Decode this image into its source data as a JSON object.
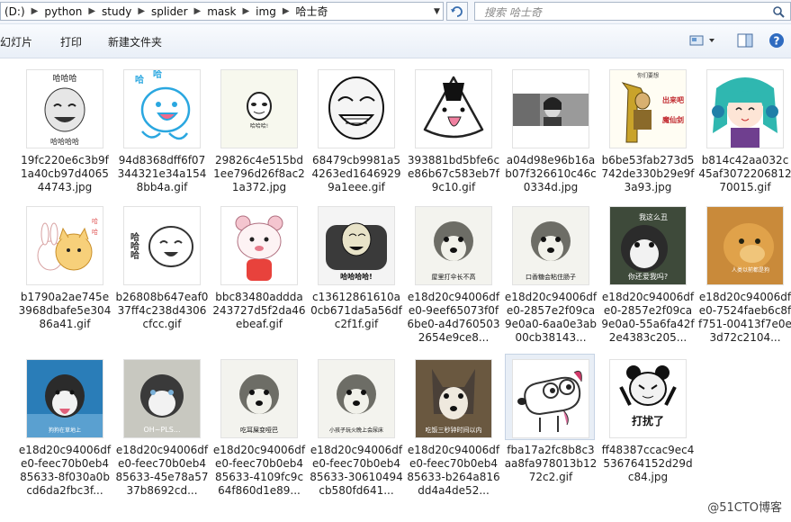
{
  "address": {
    "segments": [
      "(D:)",
      "python",
      "study",
      "splider",
      "mask",
      "img",
      "哈士奇"
    ]
  },
  "search": {
    "placeholder": "搜索 哈士奇"
  },
  "toolbar": {
    "slideshow": "幻灯片",
    "print": "打印",
    "new_folder": "新建文件夹"
  },
  "files": [
    {
      "name": "19fc220e6c3b9f1a40cb97d406544743.jpg",
      "icon": "meme-haha-face"
    },
    {
      "name": "94d8368dff6f07344321e34a1548bb4a.gif",
      "icon": "cartoon-blue-creature"
    },
    {
      "name": "29826c4e515bd1ee796d26f8ac21a372.jpg",
      "icon": "panda-face-meme"
    },
    {
      "name": "68479cb9981a54263ed16469299a1eee.gif",
      "icon": "laughing-rage-face"
    },
    {
      "name": "393881bd5bfe6ce86b67c583eb7f9c10.gif",
      "icon": "rice-ball-tongue"
    },
    {
      "name": "a04d98e96b16ab07f326610c46c0334d.jpg",
      "icon": "photo-person"
    },
    {
      "name": "b6be53fab273d5742de330b29e9f3a93.jpg",
      "icon": "warrior-meme"
    },
    {
      "name": "b814c42aa032c45af307220681270015.gif",
      "icon": "anime-girl"
    },
    {
      "name": "b1790a2ae745e3968dbafe5e30486a41.gif",
      "icon": "cat-bunny"
    },
    {
      "name": "b26808b647eaf037ff4c238d4306cfcc.gif",
      "icon": "white-blob-haha"
    },
    {
      "name": "bbc83480addda243727d5f2da46ebeaf.gif",
      "icon": "pink-bear"
    },
    {
      "name": "c13612861610a0cb671da5a56dfc2f1f.gif",
      "icon": "panda-chair-haha"
    },
    {
      "name": "e18d20c94006dfe0-9eef65073f0f6be0-a4d7605032654e9ce8...",
      "icon": "husky-photo"
    },
    {
      "name": "e18d20c94006dfe0-2857e2f09ca9e0a0-6aa0e3ab00cb38143...",
      "icon": "husky-photo"
    },
    {
      "name": "e18d20c94006dfe0-2857e2f09ca9e0a0-55a6fa42f2e4383c205...",
      "icon": "husky-photo"
    },
    {
      "name": "e18d20c94006dfe0-7524faeb6c8ff751-00413f7e0e3d72c2104...",
      "icon": "dog-photo"
    },
    {
      "name": "e18d20c94006dfe0-feec70b0eb485633-8f030a0bcd6da2fbc3f...",
      "icon": "husky-photo"
    },
    {
      "name": "e18d20c94006dfe0-feec70b0eb485633-45e78a5737b8692cd...",
      "icon": "husky-photo"
    },
    {
      "name": "e18d20c94006dfe0-feec70b0eb485633-4109fc9c64f860d1e89...",
      "icon": "husky-photo"
    },
    {
      "name": "e18d20c94006dfe0-feec70b0eb485633-30610494cb580fd641...",
      "icon": "husky-photo"
    },
    {
      "name": "e18d20c94006dfe0-feec70b0eb485633-b264a816dd4a4de52...",
      "icon": "husky-photo"
    },
    {
      "name": "fba17a2fc8b8c3aa8fa978013b1272c2.gif",
      "icon": "cartoon-dog"
    },
    {
      "name": "ff48387ccac9ec4536764152d29dc84.jpg",
      "icon": "panda-daraole"
    }
  ],
  "thumb_captions": {
    "t0_top": "哈哈哈",
    "t0_bot": "哈哈哈哈",
    "t1": "哈",
    "t2": "哈哈哈!",
    "t9": "哈哈哈",
    "t11": "哈哈哈哈!",
    "t12": "屋里打伞长不高",
    "t13": "口香糖会粘住肠子",
    "t14a": "我这么丑",
    "t14b": "你还爱我吗?",
    "t15": "人类以前都是狗",
    "t16": "狗狗在草地上",
    "t17": "OH~PLS...",
    "t18": "吃耳屎变哑巴",
    "t19": "小孩子玩火晚上会尿床",
    "t20": "吃饭三秒钟时间以内",
    "t22": "打扰了",
    "t6a": "你们要想",
    "t6b": "出来吧",
    "t6c": "魔仙剑"
  },
  "watermark": "@51CTO博客"
}
